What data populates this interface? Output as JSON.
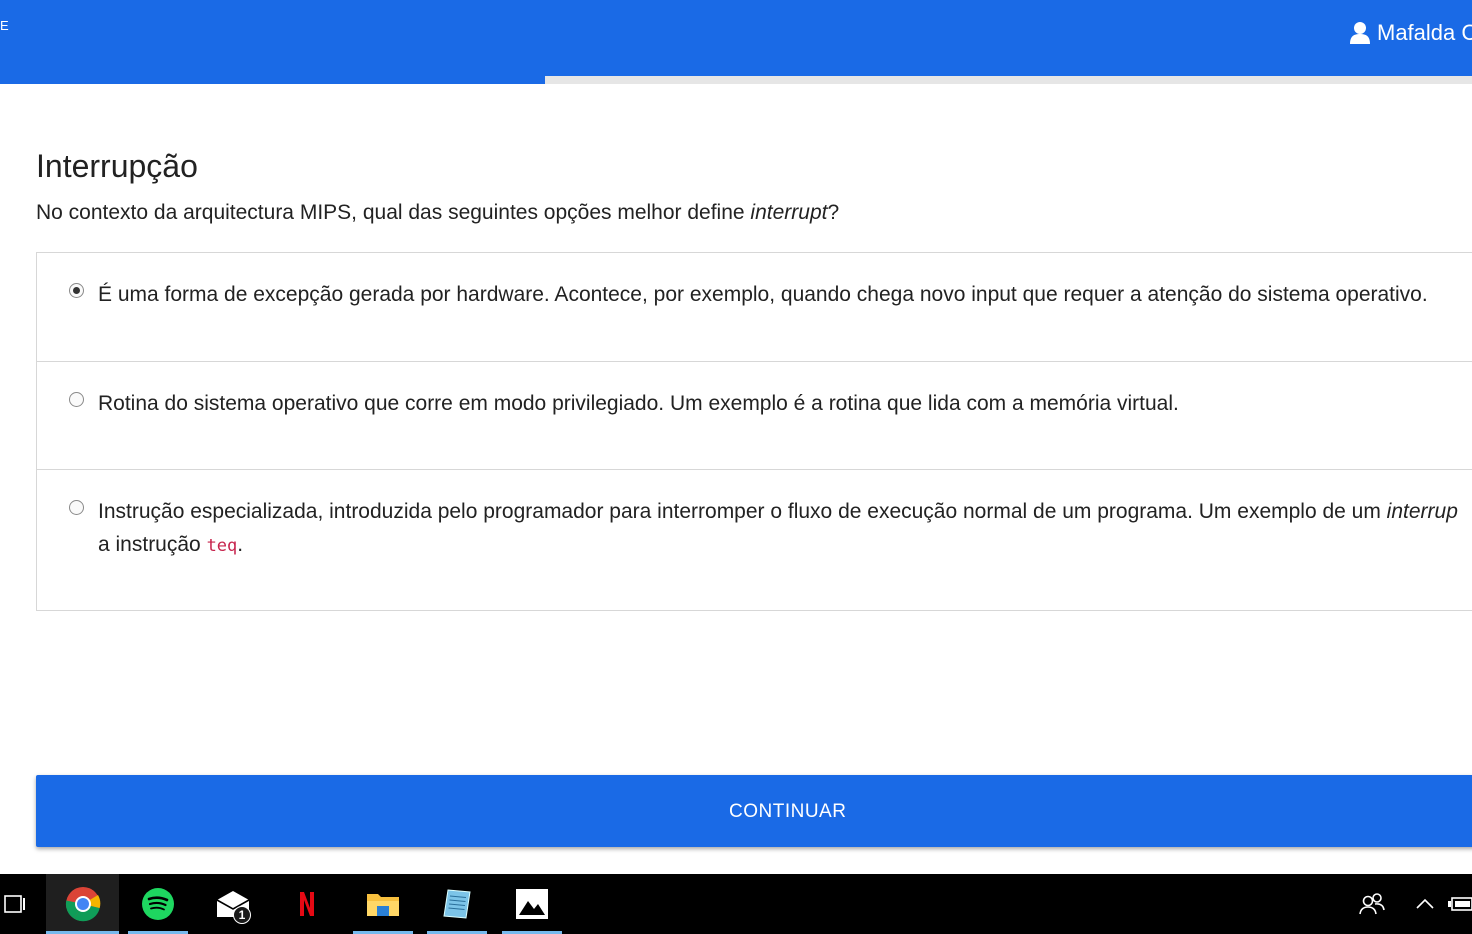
{
  "header": {
    "brand_fragment": "E",
    "user_name": "Mafalda C"
  },
  "progress": {
    "fraction": 0.37
  },
  "question": {
    "title": "Interrupção",
    "prompt_before": "No contexto da arquitectura MIPS, qual das seguintes opções melhor define ",
    "prompt_term": "interrupt",
    "prompt_after": "?"
  },
  "options": [
    {
      "text": "É uma forma de excepção gerada por hardware. Acontece, por exemplo, quando chega novo input que requer a atenção do sistema operativo.",
      "selected": true
    },
    {
      "text": "Rotina do sistema operativo que corre em modo privilegiado. Um exemplo é a rotina que lida com a memória virtual.",
      "selected": false
    },
    {
      "text_line1": "Instrução especializada, introduzida pelo programador para interromper o fluxo de execução normal de um programa. Um exemplo de um ",
      "term": "interrup",
      "text_line2_before": "a instrução ",
      "code": "teq",
      "text_line2_after": ".",
      "selected": false
    }
  ],
  "continue_label": "CONTINUAR",
  "taskbar": {
    "apps": [
      "task-view-icon",
      "chrome-icon",
      "spotify-icon",
      "mail-icon",
      "netflix-icon",
      "file-explorer-icon",
      "notepad-icon",
      "photos-icon"
    ],
    "mail_badge": "1",
    "tray": [
      "people-icon",
      "chevron-up-icon",
      "battery-icon"
    ]
  },
  "colors": {
    "accent": "#1a6ae6",
    "code": "#c7254e"
  }
}
